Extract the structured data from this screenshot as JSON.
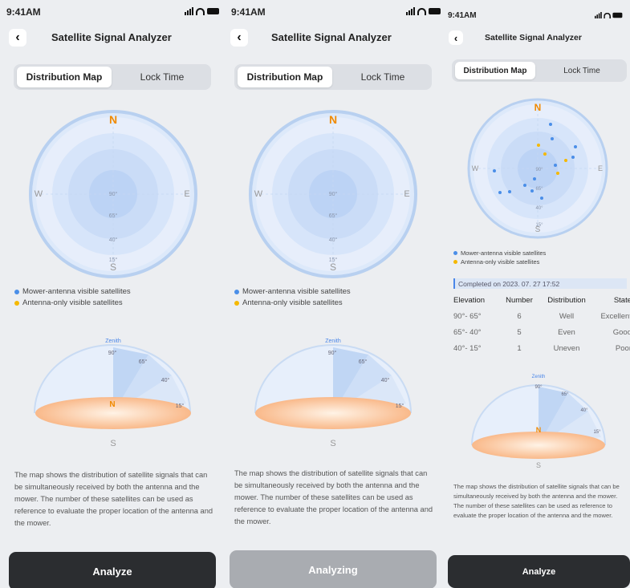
{
  "status_time": "9:41AM",
  "header_title": "Satellite Signal Analyzer",
  "tabs": {
    "map": "Distribution Map",
    "lock": "Lock Time"
  },
  "compass": {
    "n": "N",
    "s": "S",
    "e": "E",
    "w": "W",
    "r90": "90°",
    "r65": "65°",
    "r40": "40°",
    "r15": "15°"
  },
  "legend": {
    "mower": "Mower-antenna visible satellites",
    "antenna": "Antenna-only visible satellites"
  },
  "dome": {
    "zenith": "Zenith",
    "e90": "90°",
    "e65": "65°",
    "e40": "40°",
    "e15": "15°",
    "n": "N",
    "s": "S"
  },
  "description": "The map shows the distribution of satellite signals that can be simultaneously received by both the antenna and the mower. The number of these satellites can be used as reference to evaluate the proper location of the antenna and the mower.",
  "buttons": {
    "analyze": "Analyze",
    "analyzing": "Analyzing"
  },
  "result": {
    "completed": "Completed on 2023. 07. 27  17:52",
    "headers": [
      "Elevation",
      "Number",
      "Distribution",
      "State"
    ],
    "rows": [
      [
        "90°- 65°",
        "6",
        "Well",
        "Excellent"
      ],
      [
        "65°- 40°",
        "5",
        "Even",
        "Good"
      ],
      [
        "40°- 15°",
        "1",
        "Uneven",
        "Poor"
      ]
    ]
  },
  "colors": {
    "mower": "#4a8ee8",
    "antenna": "#f5b800",
    "north": "#f08a00",
    "button": "#2b2d30",
    "button_disabled": "#a9acb1"
  }
}
